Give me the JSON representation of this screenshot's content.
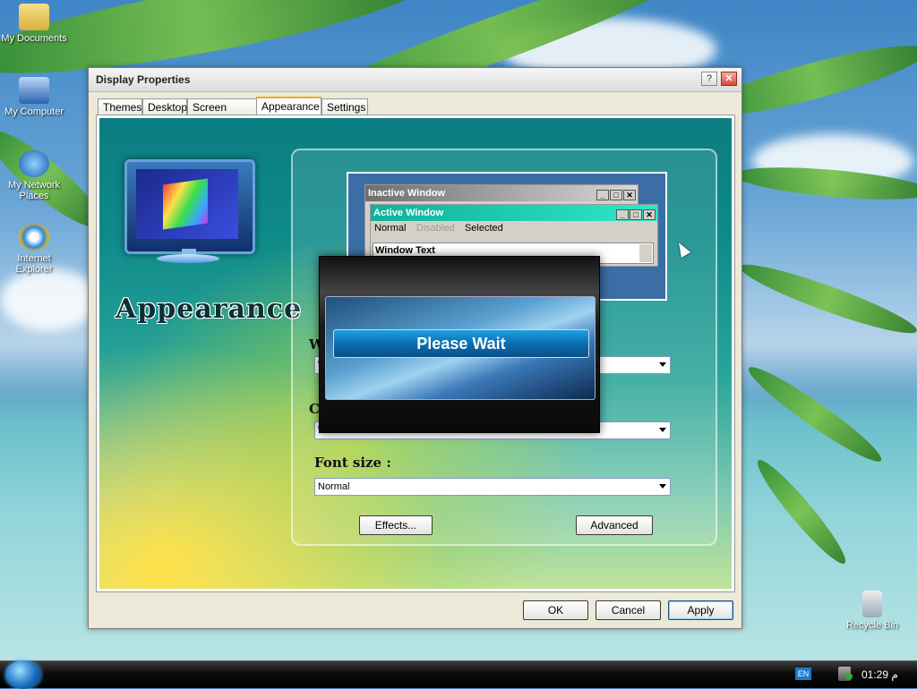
{
  "desktop": {
    "icons": [
      {
        "label": "My Documents"
      },
      {
        "label": "My Computer"
      },
      {
        "label": "My Network Places"
      },
      {
        "label": "Internet Explorer"
      },
      {
        "label": "Recycle Bin"
      }
    ]
  },
  "window": {
    "title": "Display Properties",
    "help_glyph": "?",
    "close_glyph": "✕",
    "tabs": [
      {
        "label": "Themes"
      },
      {
        "label": "Desktop"
      },
      {
        "label": "Screen Saver"
      },
      {
        "label": "Appearance",
        "active": true
      },
      {
        "label": "Settings"
      }
    ],
    "banner": "Appearance",
    "preview": {
      "inactive_title": "Inactive Window",
      "active_title": "Active Window",
      "menu": [
        "Normal",
        "Disabled",
        "Selected"
      ],
      "window_text": "Window Text"
    },
    "fields": {
      "windows_label": "W",
      "windows_value": "W",
      "color_label": "C",
      "color_value": "W",
      "fontsize_label": "Font size :",
      "fontsize_value": "Normal"
    },
    "buttons": {
      "effects": "Effects...",
      "advanced": "Advanced",
      "ok": "OK",
      "cancel": "Cancel",
      "apply": "Apply"
    }
  },
  "wait_dialog": {
    "message": "Please Wait"
  },
  "taskbar": {
    "lang": "EN",
    "clock": "01:29 م"
  },
  "colors": {
    "active_title": "#12c8a8",
    "inactive_title": "#808080",
    "accent": "#f5a623"
  }
}
